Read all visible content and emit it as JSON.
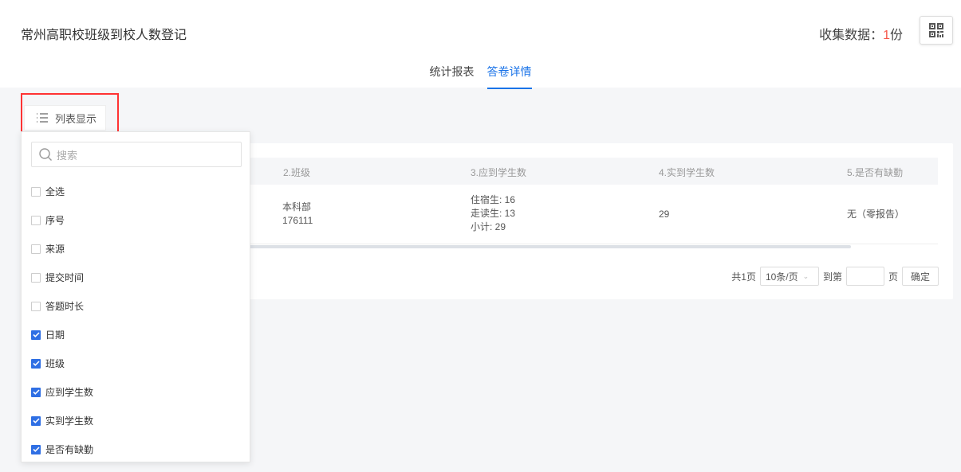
{
  "header": {
    "title": "常州高职校班级到校人数登记",
    "collect_label": "收集数据：",
    "collect_count": "1",
    "collect_unit": "份"
  },
  "tabs": [
    {
      "label": "统计报表"
    },
    {
      "label": "答卷详情",
      "active": true
    }
  ],
  "list_button": "列表显示",
  "table": {
    "columns": [
      "2.班级",
      "3.应到学生数",
      "4.实到学生数",
      "5.是否有缺勤"
    ],
    "rows": [
      {
        "class": [
          "本科部",
          "176111"
        ],
        "expected": [
          "住宿生: 16",
          "走读生: 13",
          "小计: 29"
        ],
        "actual": "29",
        "absence": "无（零报告）"
      }
    ]
  },
  "pagination": {
    "total": "共1页",
    "page_size": "10条/页",
    "goto_label": "到第",
    "page_label": "页",
    "confirm": "确定"
  },
  "dropdown": {
    "search_placeholder": "搜索",
    "items": [
      {
        "label": "全选",
        "checked": false
      },
      {
        "label": "序号",
        "checked": false
      },
      {
        "label": "来源",
        "checked": false
      },
      {
        "label": "提交时间",
        "checked": false
      },
      {
        "label": "答题时长",
        "checked": false
      },
      {
        "label": "日期",
        "checked": true
      },
      {
        "label": "班级",
        "checked": true
      },
      {
        "label": "应到学生数",
        "checked": true
      },
      {
        "label": "实到学生数",
        "checked": true
      },
      {
        "label": "是否有缺勤",
        "checked": true
      }
    ]
  },
  "colors": {
    "accent": "#1a73e8",
    "count": "#f5574a",
    "highlight": "#ff3333"
  }
}
